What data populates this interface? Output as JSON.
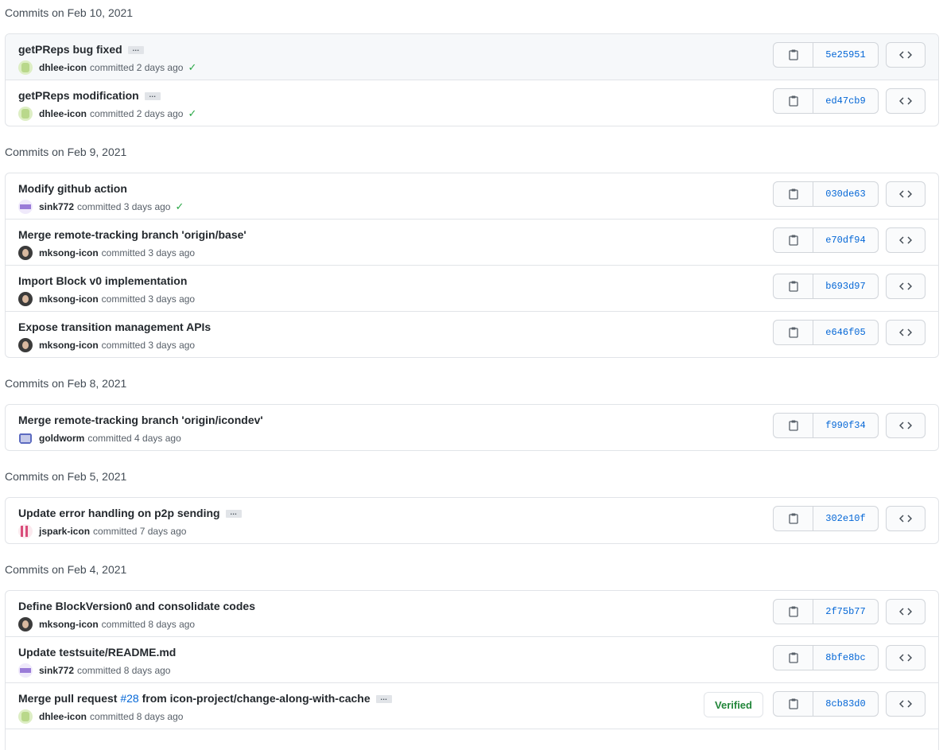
{
  "groups": [
    {
      "heading": "Commits on Feb 10, 2021",
      "commits": [
        {
          "title": "getPReps bug fixed",
          "author": "dhlee-icon",
          "action": "committed",
          "time": "2 days ago",
          "sha": "5e25951"
        },
        {
          "title": "getPReps modification",
          "author": "dhlee-icon",
          "action": "committed",
          "time": "2 days ago",
          "sha": "ed47cb9"
        }
      ]
    },
    {
      "heading": "Commits on Feb 9, 2021",
      "commits": [
        {
          "title": "Modify github action",
          "author": "sink772",
          "action": "committed",
          "time": "3 days ago",
          "sha": "030de63"
        },
        {
          "title": "Merge remote-tracking branch 'origin/base'",
          "author": "mksong-icon",
          "action": "committed",
          "time": "3 days ago",
          "sha": "e70df94"
        },
        {
          "title": "Import Block v0 implementation",
          "author": "mksong-icon",
          "action": "committed",
          "time": "3 days ago",
          "sha": "b693d97"
        },
        {
          "title": "Expose transition management APIs",
          "author": "mksong-icon",
          "action": "committed",
          "time": "3 days ago",
          "sha": "e646f05"
        }
      ]
    },
    {
      "heading": "Commits on Feb 8, 2021",
      "commits": [
        {
          "title": "Merge remote-tracking branch 'origin/icondev'",
          "author": "goldworm",
          "action": "committed",
          "time": "4 days ago",
          "sha": "f990f34"
        }
      ]
    },
    {
      "heading": "Commits on Feb 5, 2021",
      "commits": [
        {
          "title": "Update error handling on p2p sending",
          "author": "jspark-icon",
          "action": "committed",
          "time": "7 days ago",
          "sha": "302e10f"
        }
      ]
    },
    {
      "heading": "Commits on Feb 4, 2021",
      "commits": [
        {
          "title": "Define BlockVersion0 and consolidate codes",
          "author": "mksong-icon",
          "action": "committed",
          "time": "8 days ago",
          "sha": "2f75b77"
        },
        {
          "title": "Update testsuite/README.md",
          "author": "sink772",
          "action": "committed",
          "time": "8 days ago",
          "sha": "8bfe8bc"
        },
        {
          "title_prefix": "Merge pull request ",
          "pr_link": "#28",
          "title_suffix": " from icon-project/change-along-with-cache",
          "author": "dhlee-icon",
          "action": "committed",
          "time": "8 days ago",
          "sha": "8cb83d0",
          "badge": "Verified"
        }
      ]
    }
  ],
  "ellipsis_label": "…",
  "check_glyph": "✓",
  "icons": {
    "copy": "clipboard-icon",
    "browse": "code-icon",
    "status": "check-icon"
  },
  "colors": {
    "link": "#0366d6",
    "success": "#28a745",
    "border": "#e1e4e8"
  }
}
